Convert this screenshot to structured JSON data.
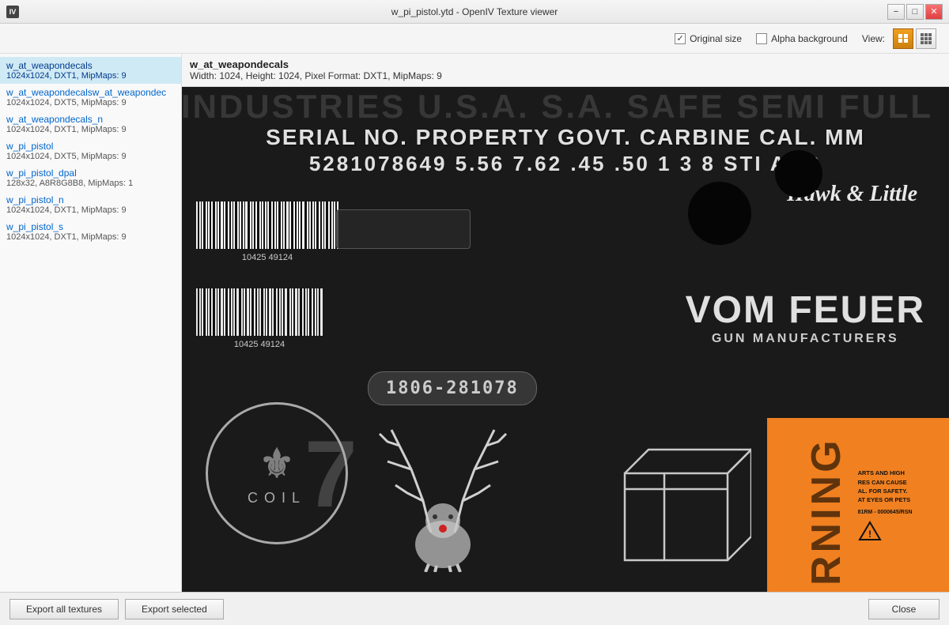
{
  "window": {
    "title": "w_pi_pistol.ytd - OpenIV Texture viewer",
    "icon_label": "IV"
  },
  "titlebar": {
    "minimize": "−",
    "restore": "□",
    "close": "✕"
  },
  "toolbar": {
    "original_size_label": "Original size",
    "alpha_background_label": "Alpha background",
    "view_label": "View:",
    "original_size_checked": true,
    "alpha_background_checked": false
  },
  "sidebar": {
    "items": [
      {
        "name": "w_at_weapondecals",
        "info": "1024x1024, DXT1, MipMaps: 9",
        "active": true
      },
      {
        "name": "w_at_weapondecalsw_at_weapondec",
        "info": "1024x1024, DXT5, MipMaps: 9",
        "active": false
      },
      {
        "name": "w_at_weapondecals_n",
        "info": "1024x1024, DXT1, MipMaps: 9",
        "active": false
      },
      {
        "name": "w_pi_pistol",
        "info": "1024x1024, DXT5, MipMaps: 9",
        "active": false
      },
      {
        "name": "w_pi_pistol_dpal",
        "info": "128x32, A8R8G8B8, MipMaps: 1",
        "active": false
      },
      {
        "name": "w_pi_pistol_n",
        "info": "1024x1024, DXT1, MipMaps: 9",
        "active": false
      },
      {
        "name": "w_pi_pistol_s",
        "info": "1024x1024, DXT1, MipMaps: 9",
        "active": false
      }
    ]
  },
  "texture_info": {
    "name": "w_at_weapondecals",
    "details": "Width: 1024, Height: 1024, Pixel Format: DXT1, MipMaps: 9"
  },
  "texture_content": {
    "industries_text": "INDUSTRIES U.S.A. S.A. SAFE SEMI FULL",
    "serial_line": "SERIAL NO. PROPERTY GOVT. CARBINE CAL. MM",
    "numbers_line": "5281078649  5.56  7.62  .45  .50  1  3  8  STI  ACB",
    "hawk_little": "Hawk & Little",
    "barcode1_num": "10425  49124",
    "barcode2_num": "10425  49124",
    "vom_feuer": "VOM FEUER",
    "gun_manufacturers": "GUN MANUFACTURERS",
    "serial_badge": "1806-281078",
    "coil_text": "COIL",
    "big_seven": "7",
    "warning_text": "RNING",
    "warning_serial": "81RM - 0000645/RSN"
  },
  "footer": {
    "export_all_label": "Export all textures",
    "export_selected_label": "Export selected",
    "close_label": "Close"
  }
}
